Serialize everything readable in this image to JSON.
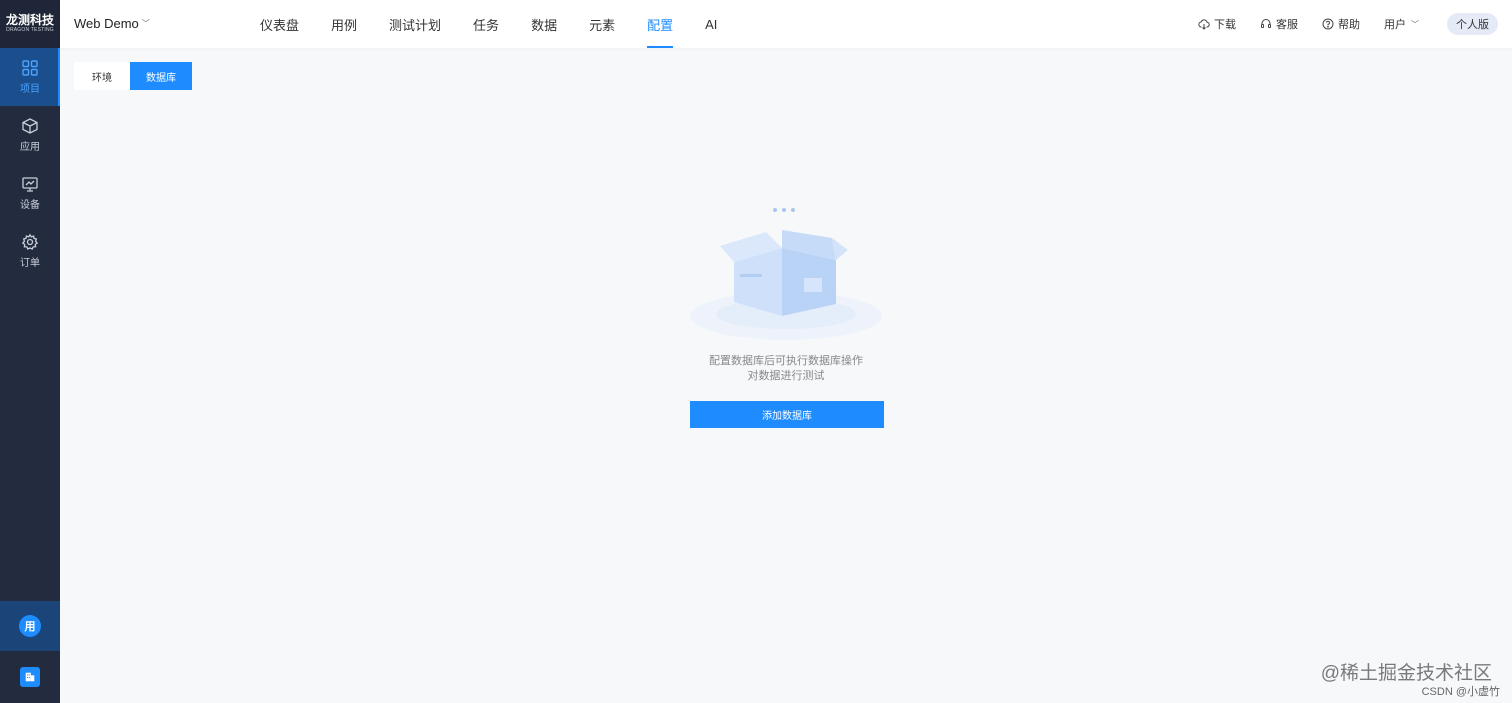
{
  "logo": {
    "main": "龙测科技",
    "sub": "DRAGON TESTING"
  },
  "sidebar": {
    "items": [
      {
        "label": "项目",
        "icon": "grid-icon",
        "active": true
      },
      {
        "label": "应用",
        "icon": "cube-icon",
        "active": false
      },
      {
        "label": "设备",
        "icon": "monitor-icon",
        "active": false
      },
      {
        "label": "订单",
        "icon": "gear-icon",
        "active": false
      }
    ],
    "user_avatar": "用"
  },
  "header": {
    "project": "Web Demo",
    "nav": [
      "仪表盘",
      "用例",
      "测试计划",
      "任务",
      "数据",
      "元素",
      "配置",
      "AI"
    ],
    "active_nav": "配置",
    "tools": {
      "download": "下载",
      "service": "客服",
      "help": "帮助",
      "user": "用户"
    },
    "edition": "个人版"
  },
  "tabs": [
    {
      "label": "环境",
      "active": false
    },
    {
      "label": "数据库",
      "active": true
    }
  ],
  "empty": {
    "line1": "配置数据库后可执行数据库操作",
    "line2": "对数据进行测试",
    "button": "添加数据库"
  },
  "watermark": {
    "main": "@稀土掘金技术社区",
    "sub": "CSDN @小虚竹"
  },
  "colors": {
    "accent": "#1e8cff",
    "sidebar": "#232b3e"
  }
}
